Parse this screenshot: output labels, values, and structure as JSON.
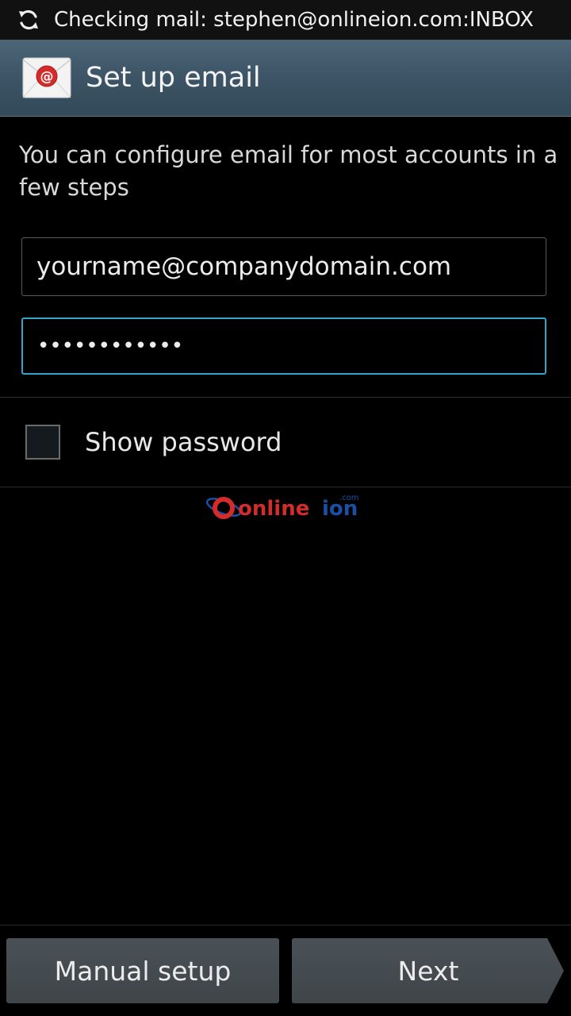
{
  "status_bar": {
    "text": "Checking mail: stephen@onlineion.com:INBOX",
    "icon": "sync-icon"
  },
  "action_bar": {
    "title": "Set up email",
    "icon": "email-app-icon"
  },
  "intro_text": "You can configure email for most accounts in a few steps",
  "email_field": {
    "value": "yourname@companydomain.com"
  },
  "password_field": {
    "value": "••••••••••••"
  },
  "show_password": {
    "label": "Show password",
    "checked": false
  },
  "watermark": {
    "text": "onlineion",
    "suffix": ".com"
  },
  "buttons": {
    "manual_setup": "Manual setup",
    "next": "Next"
  },
  "colors": {
    "accent": "#33a4cc",
    "action_bar": "#3b5364",
    "button": "#44494d",
    "brand_red": "#d42b2b",
    "brand_blue": "#1a4fa8"
  }
}
